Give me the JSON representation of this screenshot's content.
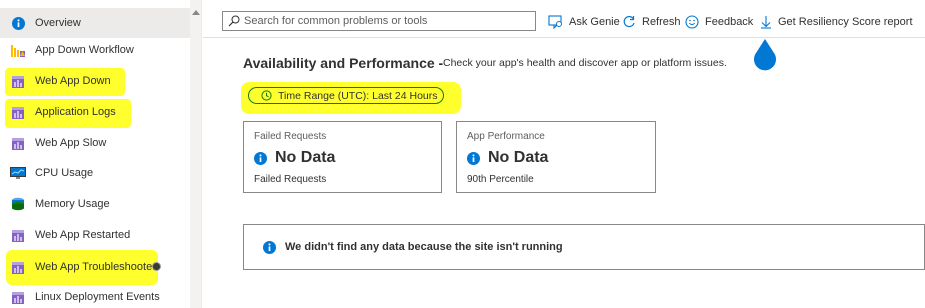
{
  "sidebar": {
    "items": [
      {
        "label": "Overview",
        "icon": "info-icon"
      },
      {
        "label": "App Down Workflow",
        "icon": "workflow-icon"
      },
      {
        "label": "Web App Down",
        "icon": "web-app-icon"
      },
      {
        "label": "Application Logs",
        "icon": "web-app-icon"
      },
      {
        "label": "Web App Slow",
        "icon": "web-app-icon"
      },
      {
        "label": "CPU Usage",
        "icon": "monitor-icon"
      },
      {
        "label": "Memory Usage",
        "icon": "database-icon"
      },
      {
        "label": "Web App Restarted",
        "icon": "web-app-icon"
      },
      {
        "label": "Web App Troubleshooter",
        "icon": "web-app-icon"
      },
      {
        "label": "Linux Deployment Events",
        "icon": "web-app-icon"
      }
    ]
  },
  "toolbar": {
    "search_placeholder": "Search for common problems or tools",
    "ask_genie": "Ask Genie",
    "refresh": "Refresh",
    "feedback": "Feedback",
    "resiliency": "Get Resiliency Score report"
  },
  "main": {
    "title": "Availability and Performance -",
    "description": "Check your app's health and discover app or platform issues.",
    "time_range": "Time Range (UTC): Last 24 Hours",
    "cards": [
      {
        "title": "Failed Requests",
        "value": "No Data",
        "subtitle": "Failed Requests"
      },
      {
        "title": "App Performance",
        "value": "No Data",
        "subtitle": "90th Percentile"
      }
    ],
    "notice": "We didn't find any data because the site isn't running"
  },
  "colors": {
    "info_blue": "#0078d4",
    "highlight_yellow": "#ffff2e",
    "pill_border_green": "#107c10"
  }
}
